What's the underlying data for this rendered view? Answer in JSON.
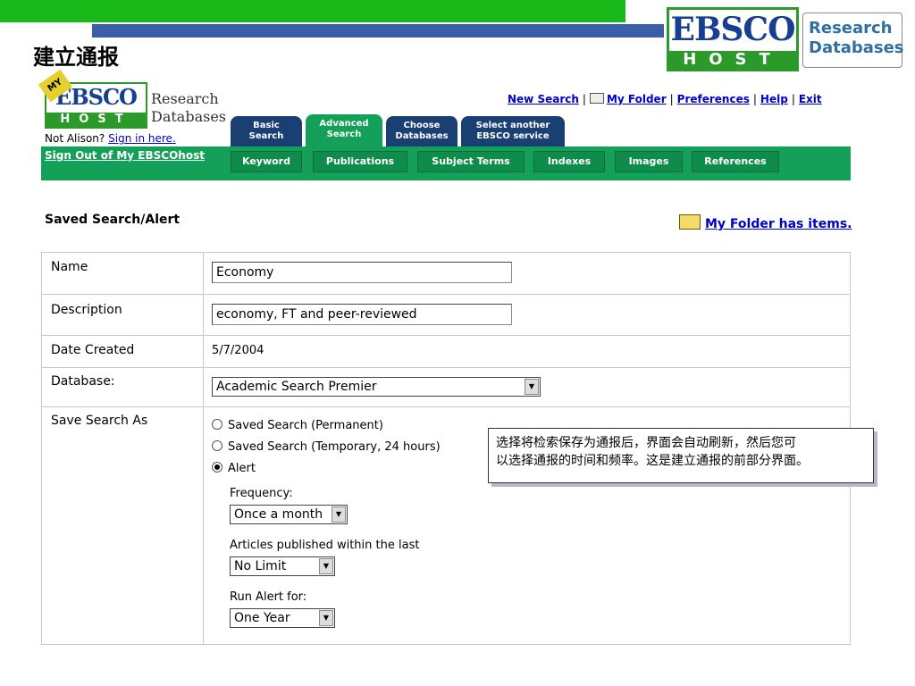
{
  "slide": {
    "title": "建立通报"
  },
  "big_logo": {
    "top": "EBSCO",
    "bottom": "HOST",
    "research_line1": "Research",
    "research_line2": "Databases"
  },
  "mini_logo": {
    "badge": "MY",
    "top": "EBSCO",
    "bottom": "HOST",
    "research": "Research",
    "databases": "Databases"
  },
  "header": {
    "not_user": "Not Alison?",
    "sign_in": "Sign in here.",
    "sign_out": "Sign Out of My EBSCOhost",
    "links": [
      "New Search",
      "My Folder",
      "Preferences",
      "Help",
      "Exit"
    ]
  },
  "tabs": [
    {
      "line1": "Basic",
      "line2": "Search",
      "active": false
    },
    {
      "line1": "Advanced",
      "line2": "Search",
      "active": true
    },
    {
      "line1": "Choose",
      "line2": "Databases",
      "active": false
    },
    {
      "line1": "Select another",
      "line2": "EBSCO service",
      "active": false
    }
  ],
  "subtabs": [
    "Keyword",
    "Publications",
    "Subject Terms",
    "Indexes",
    "Images",
    "References"
  ],
  "page": {
    "title": "Saved Search/Alert",
    "folder_msg": "My Folder has items."
  },
  "form": {
    "name_label": "Name",
    "name_value": "Economy",
    "desc_label": "Description",
    "desc_value": "economy, FT and peer-reviewed",
    "date_label": "Date Created",
    "date_value": "5/7/2004",
    "db_label": "Database:",
    "db_value": "Academic Search Premier",
    "save_label": "Save Search As",
    "options": [
      "Saved Search (Permanent)",
      "Saved Search (Temporary, 24 hours)",
      "Alert"
    ],
    "selected_option": "Alert",
    "frequency_label": "Frequency:",
    "frequency_value": "Once a month",
    "articles_label": "Articles published within the last",
    "articles_value": "No Limit",
    "run_label": "Run Alert for:",
    "run_value": "One Year"
  },
  "callout": {
    "line1": "选择将检索保存为通报后，界面会自动刷新，然后您可",
    "line2": "以选择通报的时间和频率。这是建立通报的前部分界面。"
  },
  "colors": {
    "green_bar": "#18b818",
    "blue_bar": "#3a5fa8",
    "band_green": "#14a059",
    "tab_navy": "#1a3f73",
    "link": "#0000cc"
  }
}
